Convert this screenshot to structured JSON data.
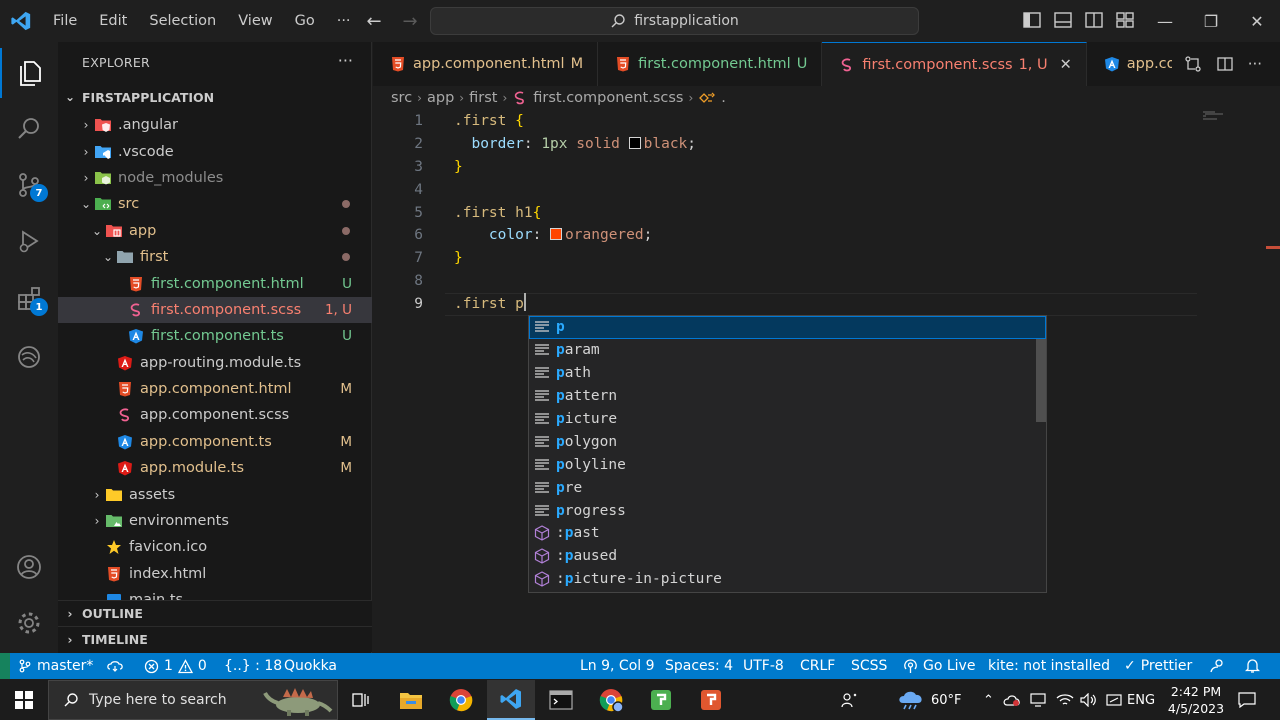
{
  "titlebar": {
    "menu": [
      "File",
      "Edit",
      "Selection",
      "View",
      "Go"
    ],
    "more": "···",
    "search_text": "firstapplication"
  },
  "activity": {
    "scm_badge": "7",
    "ext_badge": "1"
  },
  "sidebar": {
    "title": "EXPLORER",
    "more": "···",
    "folder": "FIRSTAPPLICATION",
    "items": [
      {
        "label": ".angular",
        "depth": 1,
        "chev": "›",
        "icon": "angular-folder",
        "color": "#cccccc"
      },
      {
        "label": ".vscode",
        "depth": 1,
        "chev": "›",
        "icon": "vscode-folder",
        "color": "#cccccc"
      },
      {
        "label": "node_modules",
        "depth": 1,
        "chev": "›",
        "icon": "node-folder",
        "color": "#8c8c8c"
      },
      {
        "label": "src",
        "depth": 1,
        "chev": "⌄",
        "icon": "src-folder",
        "color": "#e2c08d",
        "dot": true
      },
      {
        "label": "app",
        "depth": 2,
        "chev": "⌄",
        "icon": "app-folder",
        "color": "#e2c08d",
        "dot": true
      },
      {
        "label": "first",
        "depth": 3,
        "chev": "⌄",
        "icon": "plain-folder",
        "color": "#e2c08d",
        "dot": true
      },
      {
        "label": "first.component.html",
        "depth": 4,
        "chev": "",
        "icon": "html",
        "color": "#73c991",
        "status": "U",
        "status_color": "#73c991"
      },
      {
        "label": "first.component.scss",
        "depth": 4,
        "chev": "",
        "icon": "scss",
        "color": "#f88070",
        "status": "1, U",
        "status_color": "#f88070",
        "selected": true
      },
      {
        "label": "first.component.ts",
        "depth": 4,
        "chev": "",
        "icon": "angular-ts",
        "color": "#73c991",
        "status": "U",
        "status_color": "#73c991"
      },
      {
        "label": "app-routing.module.ts",
        "depth": 3,
        "chev": "",
        "icon": "angular",
        "color": "#cccccc"
      },
      {
        "label": "app.component.html",
        "depth": 3,
        "chev": "",
        "icon": "html",
        "color": "#e2c08d",
        "status": "M",
        "status_color": "#e2c08d"
      },
      {
        "label": "app.component.scss",
        "depth": 3,
        "chev": "",
        "icon": "scss",
        "color": "#cccccc"
      },
      {
        "label": "app.component.ts",
        "depth": 3,
        "chev": "",
        "icon": "angular-ts",
        "color": "#e2c08d",
        "status": "M",
        "status_color": "#e2c08d"
      },
      {
        "label": "app.module.ts",
        "depth": 3,
        "chev": "",
        "icon": "angular",
        "color": "#e2c08d",
        "status": "M",
        "status_color": "#e2c08d"
      },
      {
        "label": "assets",
        "depth": 2,
        "chev": "›",
        "icon": "assets-folder",
        "color": "#cccccc"
      },
      {
        "label": "environments",
        "depth": 2,
        "chev": "›",
        "icon": "env-folder",
        "color": "#cccccc"
      },
      {
        "label": "favicon.ico",
        "depth": 2,
        "chev": "",
        "icon": "star",
        "color": "#cccccc"
      },
      {
        "label": "index.html",
        "depth": 2,
        "chev": "",
        "icon": "html",
        "color": "#cccccc"
      },
      {
        "label": "main.ts",
        "depth": 2,
        "chev": "",
        "icon": "ts",
        "color": "#cccccc"
      }
    ],
    "outline": "OUTLINE",
    "timeline": "TIMELINE"
  },
  "tabs": [
    {
      "label": "app.component.html",
      "mod": "M",
      "icon": "html",
      "color": "#e2c08d"
    },
    {
      "label": "first.component.html",
      "mod": "U",
      "icon": "html",
      "color": "#73c991"
    },
    {
      "label": "first.component.scss",
      "mod": "1, U",
      "icon": "scss",
      "color": "#f88070",
      "active": true
    },
    {
      "label": "app.cor",
      "mod": "",
      "icon": "angular-ts",
      "color": "#e2c08d"
    }
  ],
  "breadcrumb": [
    "src",
    "app",
    "first",
    "first.component.scss",
    "."
  ],
  "editor": {
    "line_numbers": [
      "1",
      "2",
      "3",
      "4",
      "5",
      "6",
      "7",
      "8",
      "9"
    ],
    "l1_sel": ".first ",
    "l1_br": "{",
    "l2_prop": "border",
    "l2_colon": ": ",
    "l2_num": "1px",
    "l2_val1": " solid ",
    "l2_val2": "black",
    "l2_end": ";",
    "l3_br": "}",
    "l5_sel": ".first h1",
    "l5_br": "{",
    "l6_prop": "color",
    "l6_colon": ": ",
    "l6_val": "orangered",
    "l6_end": ";",
    "l7_br": "}",
    "l9_sel": ".first p",
    "swatch_black": "#000000",
    "swatch_orangered": "#ff4500"
  },
  "suggest": [
    {
      "hl": "p",
      "rest": "",
      "kind": "property",
      "active": true
    },
    {
      "hl": "p",
      "rest": "aram",
      "kind": "property"
    },
    {
      "hl": "p",
      "rest": "ath",
      "kind": "property"
    },
    {
      "hl": "p",
      "rest": "attern",
      "kind": "property"
    },
    {
      "hl": "p",
      "rest": "icture",
      "kind": "property"
    },
    {
      "hl": "p",
      "rest": "olygon",
      "kind": "property"
    },
    {
      "hl": "p",
      "rest": "olyline",
      "kind": "property"
    },
    {
      "hl": "p",
      "rest": "re",
      "kind": "property"
    },
    {
      "hl": "p",
      "rest": "rogress",
      "kind": "property"
    },
    {
      "pre": ":",
      "hl": "p",
      "rest": "ast",
      "kind": "pseudo"
    },
    {
      "pre": ":",
      "hl": "p",
      "rest": "aused",
      "kind": "pseudo"
    },
    {
      "pre": ":",
      "hl": "p",
      "rest": "icture-in-picture",
      "kind": "pseudo"
    }
  ],
  "statusbar": {
    "branch": "master*",
    "errors": "1",
    "warnings": "0",
    "braces": "{..} : 18",
    "quokka": "Quokka",
    "position": "Ln 9, Col 9",
    "spaces": "Spaces: 4",
    "encoding": "UTF-8",
    "eol": "CRLF",
    "language": "SCSS",
    "golive": "Go Live",
    "kite": "kite: not installed",
    "prettier": "Prettier"
  },
  "taskbar": {
    "search_placeholder": "Type here to search",
    "weather": "60°F",
    "lang": "ENG",
    "time": "2:42 PM",
    "date": "4/5/2023"
  }
}
